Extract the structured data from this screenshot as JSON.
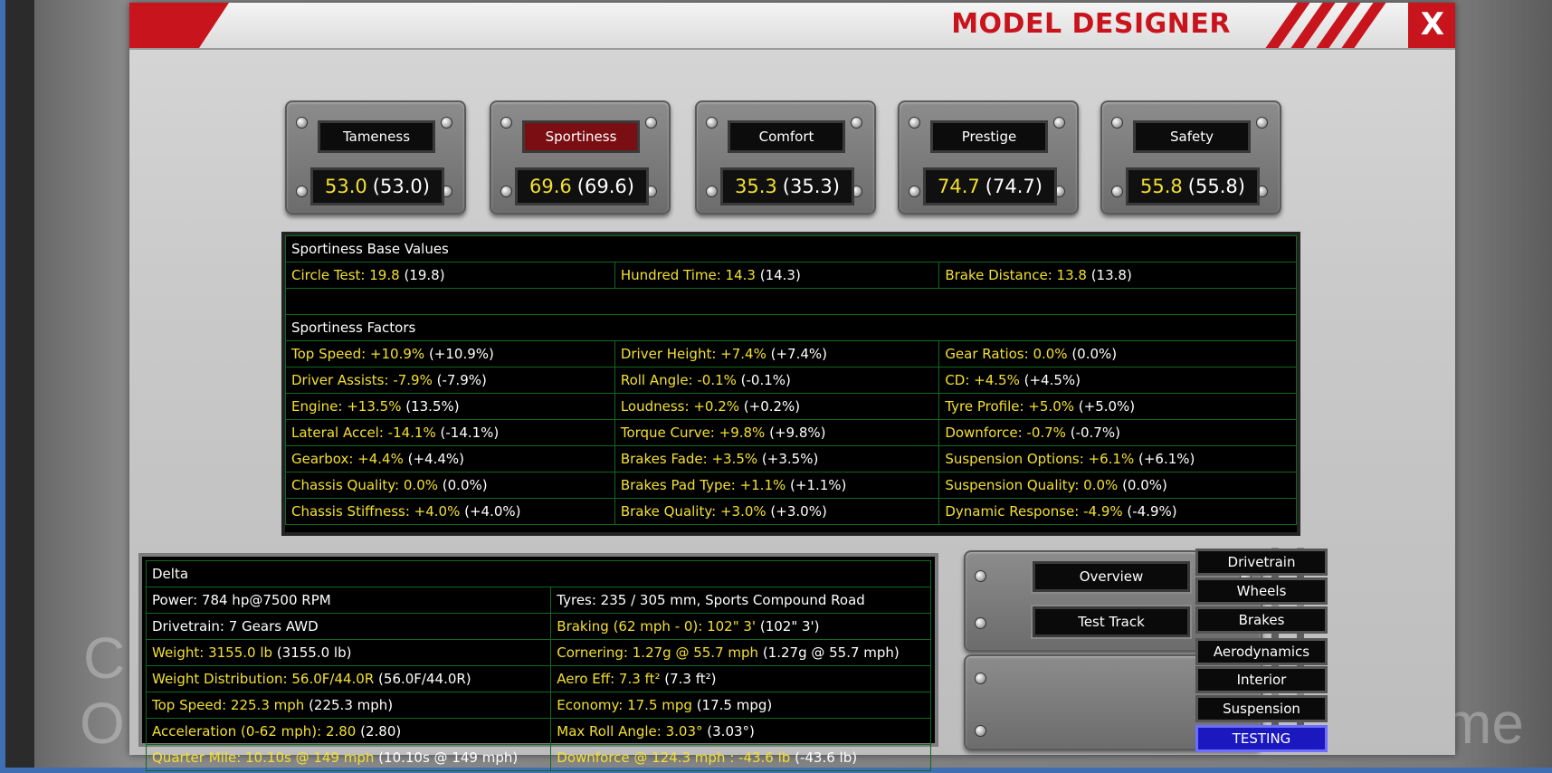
{
  "window": {
    "title": "MODEL DESIGNER",
    "close_label": "X"
  },
  "background_text": {
    "c": "C",
    "o": "O",
    "me": "me"
  },
  "ratings": [
    {
      "label": "Tameness",
      "value": "53.0",
      "base": "(53.0)",
      "active": false
    },
    {
      "label": "Sportiness",
      "value": "69.6",
      "base": "(69.6)",
      "active": true
    },
    {
      "label": "Comfort",
      "value": "35.3",
      "base": "(35.3)",
      "active": false
    },
    {
      "label": "Prestige",
      "value": "74.7",
      "base": "(74.7)",
      "active": false
    },
    {
      "label": "Safety",
      "value": "55.8",
      "base": "(55.8)",
      "active": false
    }
  ],
  "sportiness": {
    "base_title": "Sportiness Base Values",
    "base": [
      {
        "label": "Circle Test: 19.8",
        "base": "(19.8)"
      },
      {
        "label": "Hundred Time: 14.3",
        "base": "(14.3)"
      },
      {
        "label": "Brake Distance: 13.8",
        "base": "(13.8)"
      }
    ],
    "factors_title": "Sportiness Factors",
    "factors": [
      [
        {
          "label": "Top Speed: +10.9%",
          "base": "(+10.9%)"
        },
        {
          "label": "Driver Height: +7.4%",
          "base": "(+7.4%)"
        },
        {
          "label": "Gear Ratios: 0.0%",
          "base": "(0.0%)"
        }
      ],
      [
        {
          "label": "Driver Assists: -7.9%",
          "base": "(-7.9%)"
        },
        {
          "label": "Roll Angle: -0.1%",
          "base": "(-0.1%)"
        },
        {
          "label": "CD: +4.5%",
          "base": "(+4.5%)"
        }
      ],
      [
        {
          "label": "Engine: +13.5%",
          "base": "(13.5%)"
        },
        {
          "label": "Loudness: +0.2%",
          "base": "(+0.2%)"
        },
        {
          "label": "Tyre Profile: +5.0%",
          "base": "(+5.0%)"
        }
      ],
      [
        {
          "label": "Lateral Accel: -14.1%",
          "base": "(-14.1%)"
        },
        {
          "label": "Torque Curve: +9.8%",
          "base": "(+9.8%)"
        },
        {
          "label": "Downforce: -0.7%",
          "base": "(-0.7%)"
        }
      ],
      [
        {
          "label": "Gearbox: +4.4%",
          "base": "(+4.4%)"
        },
        {
          "label": "Brakes Fade: +3.5%",
          "base": "(+3.5%)"
        },
        {
          "label": "Suspension Options: +6.1%",
          "base": "(+6.1%)"
        }
      ],
      [
        {
          "label": "Chassis Quality: 0.0%",
          "base": "(0.0%)"
        },
        {
          "label": "Brakes Pad Type: +1.1%",
          "base": "(+1.1%)"
        },
        {
          "label": "Suspension Quality: 0.0%",
          "base": "(0.0%)"
        }
      ],
      [
        {
          "label": "Chassis Stiffness: +4.0%",
          "base": "(+4.0%)"
        },
        {
          "label": "Brake Quality: +3.0%",
          "base": "(+3.0%)"
        },
        {
          "label": "Dynamic Response: -4.9%",
          "base": "(-4.9%)"
        }
      ]
    ]
  },
  "stats": {
    "name": "Delta",
    "power": "Power: 784 hp@7500 RPM",
    "tyres": "Tyres: 235 / 305 mm, Sports Compound Road",
    "drivetrain": "Drivetrain: 7 Gears AWD",
    "braking": {
      "label": "Braking (62 mph - 0): 102\" 3'",
      "base": "(102\" 3')"
    },
    "weight": {
      "label": "Weight: 3155.0 lb",
      "base": "(3155.0 lb)"
    },
    "cornering": {
      "label": "Cornering: 1.27g @ 55.7 mph",
      "base": "(1.27g @ 55.7 mph)"
    },
    "weight_dist": {
      "label": "Weight Distribution: 56.0F/44.0R",
      "base": "(56.0F/44.0R)"
    },
    "aero": {
      "label": "Aero Eff: 7.3 ft²",
      "base": "(7.3 ft²)"
    },
    "top_speed": {
      "label": "Top Speed: 225.3 mph",
      "base": "(225.3 mph)"
    },
    "economy": {
      "label": "Economy: 17.5 mpg",
      "base": "(17.5 mpg)"
    },
    "acceleration": {
      "label": "Acceleration (0-62 mph): 2.80",
      "base": "(2.80)"
    },
    "roll": {
      "label": "Max Roll Angle: 3.03°",
      "base": "(3.03°)"
    },
    "quarter": {
      "label": "Quarter Mile: 10.10s @ 149 mph",
      "base": "(10.10s @ 149 mph)"
    },
    "downforce": {
      "label": "Downforce @ 124.3 mph : -43.6 lb",
      "base": "(-43.6 lb)"
    }
  },
  "actions": {
    "overview": "Overview",
    "test_track": "Test Track"
  },
  "side_menu": [
    "Drivetrain",
    "Wheels",
    "Brakes",
    "Aerodynamics",
    "Interior",
    "Suspension",
    "TESTING"
  ],
  "side_menu_active": "TESTING",
  "colors": {
    "accent_red": "#c8141c",
    "value_yellow": "#f2e030",
    "grid_green": "#0f6a1e",
    "active_blue": "#1b18c0"
  }
}
